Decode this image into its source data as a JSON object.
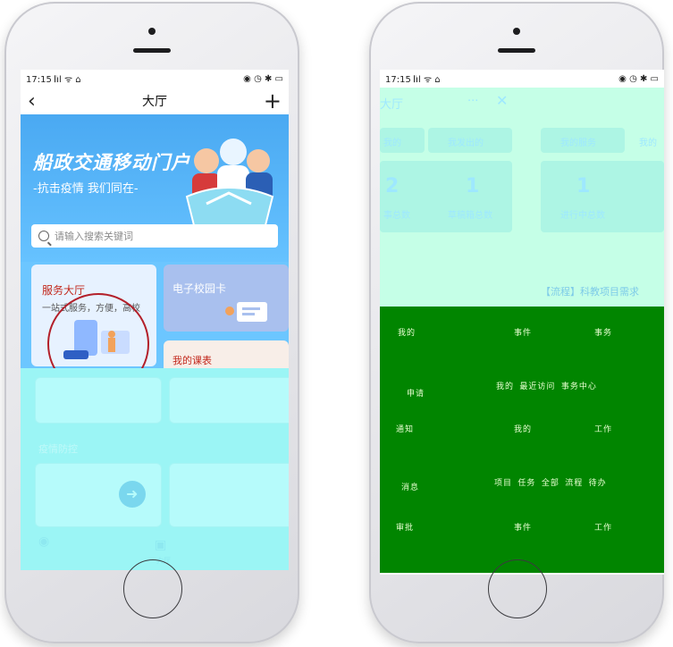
{
  "left_phone": {
    "status": {
      "time": "17:15",
      "signal": "𝄃ıl ᯤ ⌂",
      "right": "◉ ◷ ✱ ▭"
    },
    "nav": {
      "back": "‹",
      "title": "大厅",
      "plus": "+"
    },
    "banner": {
      "title": "船政交通移动门户",
      "subtitle": "-抗击疫情 我们同在-"
    },
    "search": {
      "placeholder": "请输入搜索关键词"
    },
    "cards": {
      "service_title": "服务大厅",
      "service_desc": "一站式服务，方便，高校",
      "ecard_title": "电子校园卡",
      "course_title": "我的课表"
    },
    "section_title": "疫情防控",
    "tab_label": "大厅"
  },
  "right_phone": {
    "status": {
      "time": "17:15",
      "signal": "𝄃ıl ᯤ ⌂",
      "right": "◉ ◷ ✱ ▭"
    },
    "nav": {
      "title_partial": "大厅",
      "dots": "···",
      "close": "✕"
    },
    "tabs": {
      "t1": "我的",
      "t2": "我发出的",
      "t3": "我的服务",
      "t4": "我的"
    },
    "stats": {
      "n1": "2",
      "n2": "1",
      "l1": "事总数",
      "l2": "草稿箱总数",
      "n3": "1",
      "l3": "进行中总数"
    },
    "process_text": "【流程】科教项目需求",
    "green_rows": [
      [
        "我的",
        "事件",
        "事务"
      ],
      [
        "申请",
        "我的 最近访问 事务中心"
      ],
      [
        "通知",
        "我的",
        "工作"
      ],
      [
        "消息",
        "项目 任务 全部 流程 待办"
      ],
      [
        "审批",
        "事件",
        "工作"
      ]
    ]
  }
}
